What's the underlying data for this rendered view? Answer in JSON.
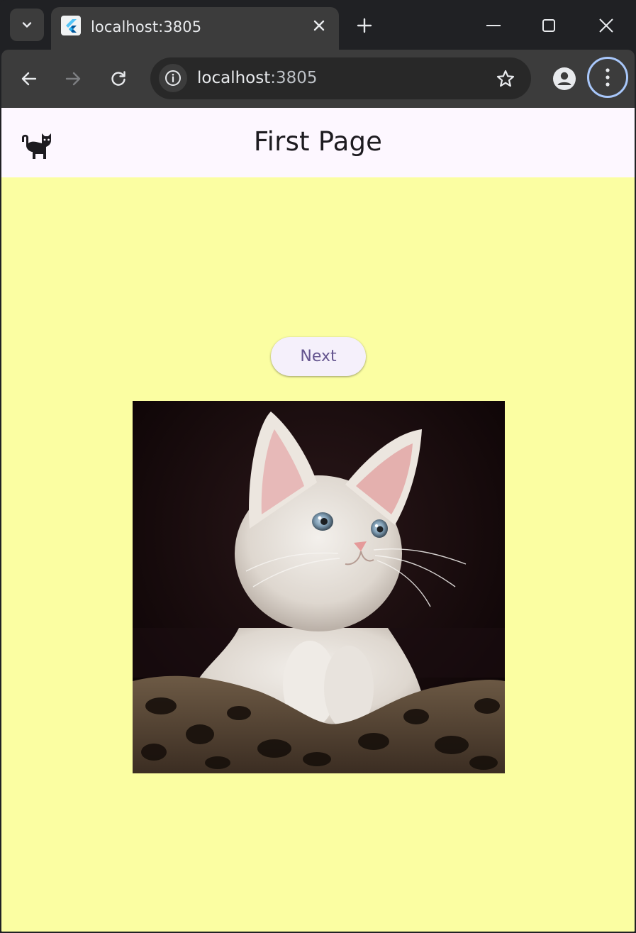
{
  "browser": {
    "tab_title": "localhost:3805",
    "url_host": "localhost",
    "url_port": ":3805",
    "icons": {
      "tab_search": "chevron-down-icon",
      "favicon": "flutter-icon",
      "tab_close": "close-icon",
      "new_tab": "plus-icon",
      "minimize": "minimize-icon",
      "maximize": "maximize-icon",
      "close_window": "close-icon",
      "back": "arrow-left-icon",
      "forward": "arrow-right-icon",
      "reload": "reload-icon",
      "site_info": "info-icon",
      "bookmark": "star-icon",
      "profile": "person-icon",
      "menu": "more-vert-icon"
    }
  },
  "app": {
    "appbar": {
      "leading_icon": "cat-icon",
      "title": "First Page",
      "background": "#fdf7ff"
    },
    "body_background": "#fbfea2",
    "next_button": {
      "label": "Next",
      "text_color": "#65558f"
    },
    "image": {
      "subject": "white kitten photo"
    }
  }
}
